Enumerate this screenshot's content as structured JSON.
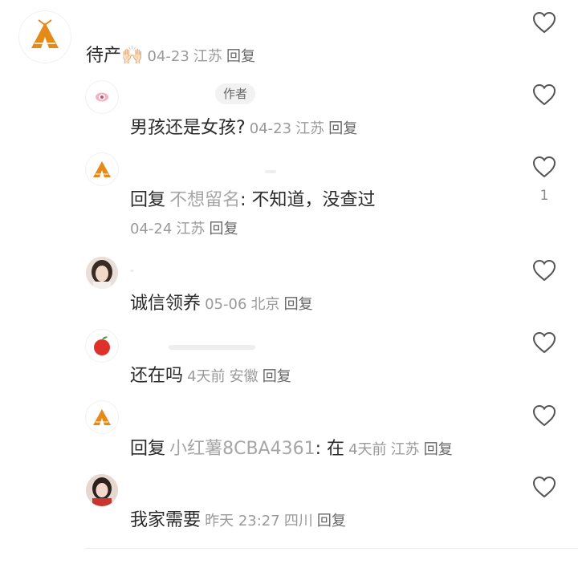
{
  "comments": [
    {
      "avatar": "tent-icon",
      "content": "待产",
      "emoji": "🙌🏻",
      "date": "04-23",
      "location": "江苏",
      "reply_label": "回复"
    },
    {
      "avatar": "eye-icon",
      "badge": "作者",
      "content": "男孩还是女孩?",
      "date": "04-23",
      "location": "江苏",
      "reply_label": "回复"
    },
    {
      "avatar": "tent-icon",
      "reply_prefix": "回复",
      "reply_to": "不想留名",
      "content": ": 不知道，没查过",
      "date": "04-24",
      "location": "江苏",
      "reply_label": "回复",
      "likes": "1"
    },
    {
      "avatar": "girl-photo",
      "content": "诚信领养",
      "date": "05-06",
      "location": "北京",
      "reply_label": "回复"
    },
    {
      "avatar": "apple-icon",
      "content": "还在吗",
      "date": "4天前",
      "location": "安徽",
      "reply_label": "回复"
    },
    {
      "avatar": "tent-icon",
      "reply_prefix": "回复",
      "reply_to": "小红薯8CBA4361",
      "content": ": 在",
      "date": "4天前",
      "location": "江苏",
      "reply_label": "回复"
    },
    {
      "avatar": "girl-photo",
      "content": "我家需要",
      "date": "昨天 23:27",
      "location": "四川",
      "reply_label": "回复"
    }
  ],
  "colors": {
    "tent": "#e48a19",
    "apple": "#e0302a",
    "muted": "#9a9a9a",
    "text": "#2b2b2b"
  }
}
